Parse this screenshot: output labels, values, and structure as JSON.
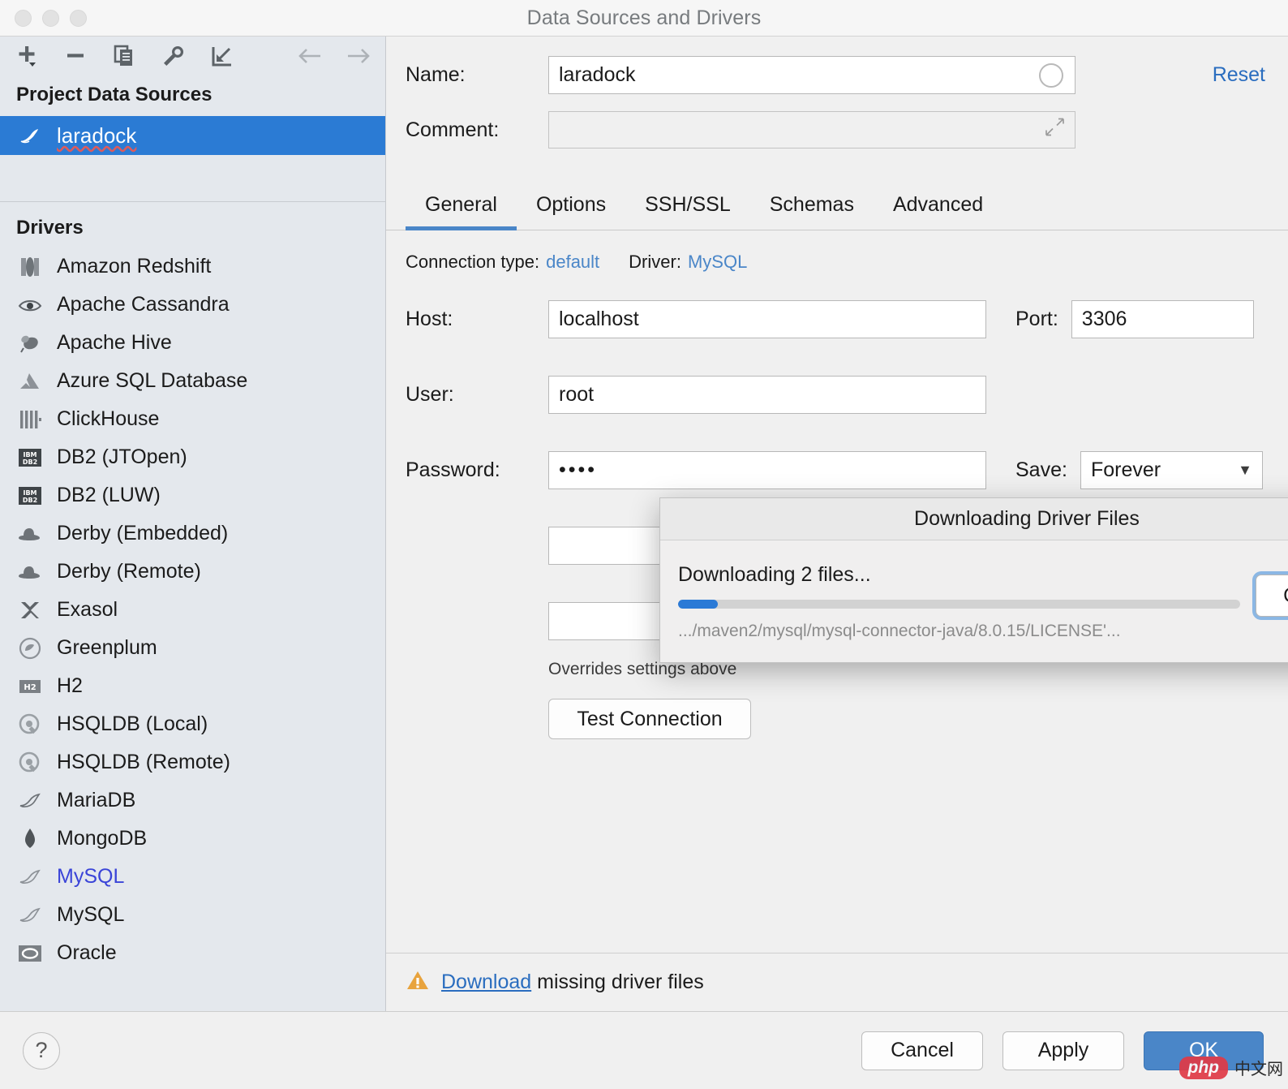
{
  "window": {
    "title": "Data Sources and Drivers",
    "traffic_lights": [
      "close",
      "minimize",
      "zoom"
    ]
  },
  "sidebar": {
    "toolbar": [
      {
        "name": "add-data-source-button",
        "icon": "plus-dropdown-icon"
      },
      {
        "name": "remove-data-source-button",
        "icon": "minus-icon"
      },
      {
        "name": "duplicate-data-source-button",
        "icon": "copy-icon"
      },
      {
        "name": "properties-button",
        "icon": "wrench-icon"
      },
      {
        "name": "import-button",
        "icon": "import-arrow-icon"
      },
      {
        "name": "back-button",
        "icon": "arrow-left-icon"
      },
      {
        "name": "forward-button",
        "icon": "arrow-right-icon"
      }
    ],
    "project_section_title": "Project Data Sources",
    "data_sources": [
      {
        "label": "laradock",
        "icon": "mysql-dolphin-icon",
        "selected": true
      }
    ],
    "drivers_section_title": "Drivers",
    "drivers": [
      {
        "label": "Amazon Redshift",
        "icon": "redshift-icon"
      },
      {
        "label": "Apache Cassandra",
        "icon": "cassandra-eye-icon"
      },
      {
        "label": "Apache Hive",
        "icon": "hive-bee-icon"
      },
      {
        "label": "Azure SQL Database",
        "icon": "azure-icon"
      },
      {
        "label": "ClickHouse",
        "icon": "clickhouse-bars-icon"
      },
      {
        "label": "DB2 (JTOpen)",
        "icon": "ibm-db2-icon"
      },
      {
        "label": "DB2 (LUW)",
        "icon": "ibm-db2-icon"
      },
      {
        "label": "Derby (Embedded)",
        "icon": "derby-hat-icon"
      },
      {
        "label": "Derby (Remote)",
        "icon": "derby-hat-icon"
      },
      {
        "label": "Exasol",
        "icon": "exasol-x-icon"
      },
      {
        "label": "Greenplum",
        "icon": "greenplum-icon"
      },
      {
        "label": "H2",
        "icon": "h2-icon"
      },
      {
        "label": "HSQLDB (Local)",
        "icon": "hsqldb-icon"
      },
      {
        "label": "HSQLDB (Remote)",
        "icon": "hsqldb-icon"
      },
      {
        "label": "MariaDB",
        "icon": "mariadb-seal-icon"
      },
      {
        "label": "MongoDB",
        "icon": "mongodb-leaf-icon"
      },
      {
        "label": "MySQL",
        "icon": "mysql-dolphin-icon",
        "accent": true
      },
      {
        "label": "MySQL",
        "icon": "mysql-dolphin-icon"
      },
      {
        "label": "Oracle",
        "icon": "oracle-icon"
      }
    ]
  },
  "main": {
    "name_label": "Name:",
    "name_value": "laradock",
    "name_placeholder": "",
    "comment_label": "Comment:",
    "comment_value": "",
    "comment_placeholder": "",
    "reset_label": "Reset",
    "tabs": [
      {
        "label": "General",
        "active": true
      },
      {
        "label": "Options",
        "active": false
      },
      {
        "label": "SSH/SSL",
        "active": false
      },
      {
        "label": "Schemas",
        "active": false
      },
      {
        "label": "Advanced",
        "active": false
      }
    ],
    "general": {
      "connection_type_label": "Connection type:",
      "connection_type_value": "default",
      "driver_label": "Driver:",
      "driver_value": "MySQL",
      "host_label": "Host:",
      "host_value": "localhost",
      "port_label": "Port:",
      "port_value": "3306",
      "user_label": "User:",
      "user_value": "root",
      "password_label": "Password:",
      "password_value": "••••",
      "save_label": "Save:",
      "save_value": "Forever",
      "overrides_note": "Overrides settings above",
      "test_connection_label": "Test Connection"
    }
  },
  "warning": {
    "icon": "warning-triangle-icon",
    "link_label": "Download",
    "text": "missing driver files"
  },
  "footer": {
    "help_label": "?",
    "cancel_label": "Cancel",
    "apply_label": "Apply",
    "ok_label": "OK"
  },
  "modal": {
    "title": "Downloading Driver Files",
    "status": "Downloading 2 files...",
    "progress_percent": 7,
    "path": ".../maven2/mysql/mysql-connector-java/8.0.15/LICENSE'...",
    "cancel_label": "Cancel"
  },
  "watermark": {
    "php_label": "php",
    "cn_label": "中文网"
  },
  "colors": {
    "selection_blue": "#2b7bd4",
    "accent_blue": "#4a86c8",
    "link_blue": "#2a6dbf",
    "driver_accent": "#3a44d8",
    "progress_blue": "#2b7ad6",
    "warning_amber": "#e8a33d",
    "sidebar_bg": "#e4e8ed",
    "panel_bg": "#f0f0f0"
  }
}
